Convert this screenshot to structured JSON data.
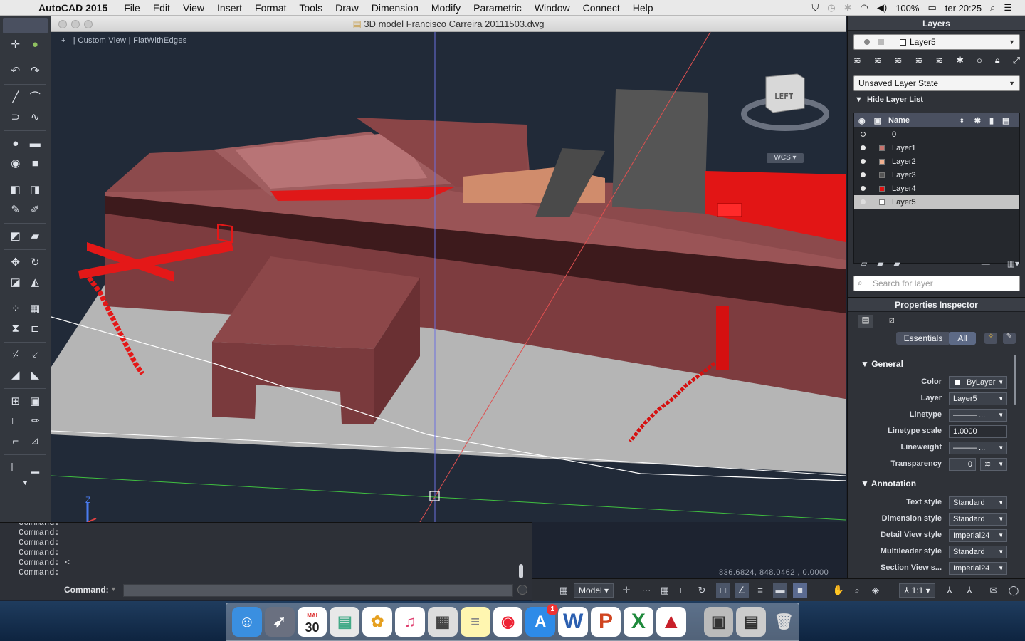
{
  "menubar": {
    "app_name": "AutoCAD 2015",
    "items": [
      "File",
      "Edit",
      "View",
      "Insert",
      "Format",
      "Tools",
      "Draw",
      "Dimension",
      "Modify",
      "Parametric",
      "Window",
      "Connect",
      "Help"
    ],
    "battery": "100%",
    "clock": "ter 20:25"
  },
  "window": {
    "title": "3D model Francisco Carreira 20111503.dwg"
  },
  "viewport": {
    "label_view": "Custom View",
    "label_style": "FlatWithEdges",
    "viewcube_face": "LEFT",
    "wcs_label": "WCS",
    "coords": "836.6824,  848.0462 , 0.0000",
    "ucs_axis": "Z"
  },
  "command": {
    "history": [
      "Command:",
      "Command:",
      "Command:",
      "Command:",
      "Command: <",
      "Command:"
    ],
    "label": "Command:",
    "value": ""
  },
  "statusbar": {
    "model_label": "Model",
    "scale_label": "1:1"
  },
  "layers_panel": {
    "title": "Layers",
    "current_layer": "Layer5",
    "layer_state": "Unsaved Layer State",
    "hide_list": "Hide Layer List",
    "name_header": "Name",
    "search_placeholder": "Search for layer",
    "rows": [
      {
        "name": "0",
        "color": "#ffffff"
      },
      {
        "name": "Layer1",
        "color": "#c8746e"
      },
      {
        "name": "Layer2",
        "color": "#f0b090"
      },
      {
        "name": "Layer3",
        "color": "#555555"
      },
      {
        "name": "Layer4",
        "color": "#e01010"
      },
      {
        "name": "Layer5",
        "color": "#ffffff"
      }
    ]
  },
  "properties": {
    "title": "Properties Inspector",
    "tab_essentials": "Essentials",
    "tab_all": "All",
    "general": "General",
    "annotation": "Annotation",
    "fields": [
      {
        "label": "Color",
        "value": "ByLayer"
      },
      {
        "label": "Layer",
        "value": "Layer5"
      },
      {
        "label": "Linetype",
        "value": "——— ..."
      },
      {
        "label": "Linetype scale",
        "value": "1.0000"
      },
      {
        "label": "Lineweight",
        "value": "——— ..."
      },
      {
        "label": "Transparency",
        "value": "0"
      }
    ],
    "annotation_fields": [
      {
        "label": "Text style",
        "value": "Standard"
      },
      {
        "label": "Dimension style",
        "value": "Standard"
      },
      {
        "label": "Detail View style",
        "value": "Imperial24"
      },
      {
        "label": "Multileader style",
        "value": "Standard"
      },
      {
        "label": "Section View s...",
        "value": "Imperial24"
      }
    ]
  },
  "dock": {
    "calendar_day": "30",
    "calendar_month": "MAI",
    "appstore_badge": "1"
  },
  "colors": {
    "model_fill": "#7d3c3f",
    "accent_red": "#e01818",
    "ground": "#b5b5b5",
    "viewport_bg": "#212a38"
  }
}
